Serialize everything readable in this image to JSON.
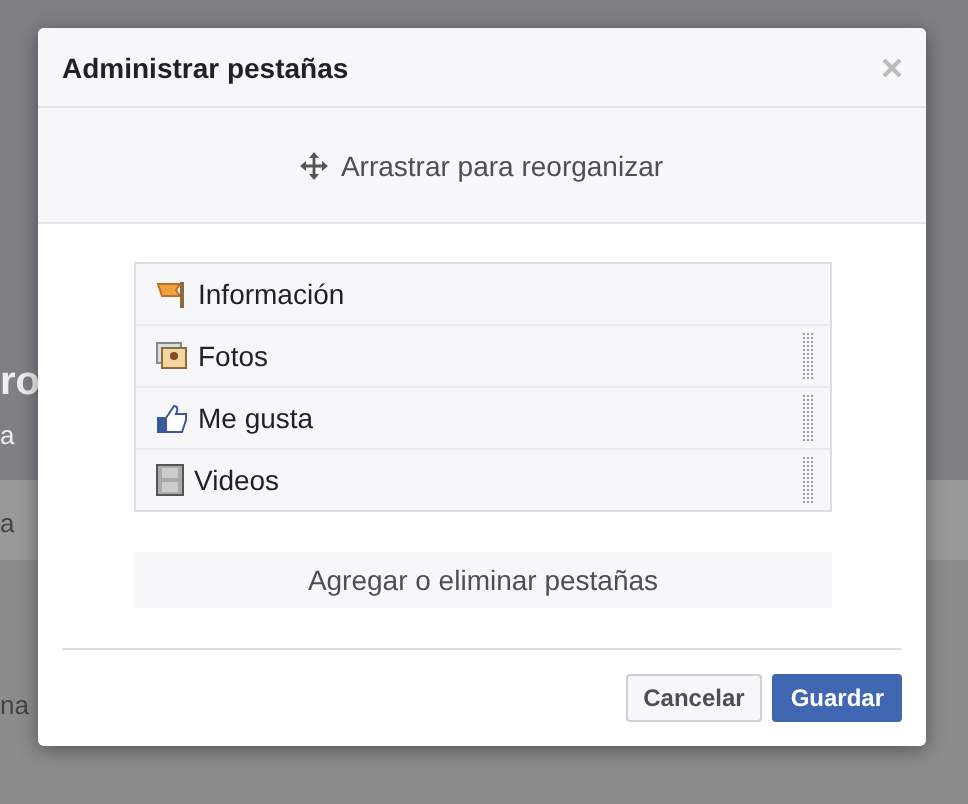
{
  "background": {
    "fragments": [
      "ro",
      "a",
      "a",
      "na"
    ]
  },
  "dialog": {
    "title": "Administrar pestañas",
    "hint": "Arrastrar para reorganizar",
    "tabs": [
      {
        "label": "Información",
        "kind": "info",
        "draggable": false
      },
      {
        "label": "Fotos",
        "kind": "photos",
        "draggable": true
      },
      {
        "label": "Me gusta",
        "kind": "likes",
        "draggable": true
      },
      {
        "label": "Videos",
        "kind": "videos",
        "draggable": true
      }
    ],
    "add_button": "Agregar o eliminar pestañas",
    "buttons": [
      {
        "label": "Cancelar",
        "kind": "secondary"
      },
      {
        "label": "Guardar",
        "kind": "primary"
      }
    ]
  }
}
